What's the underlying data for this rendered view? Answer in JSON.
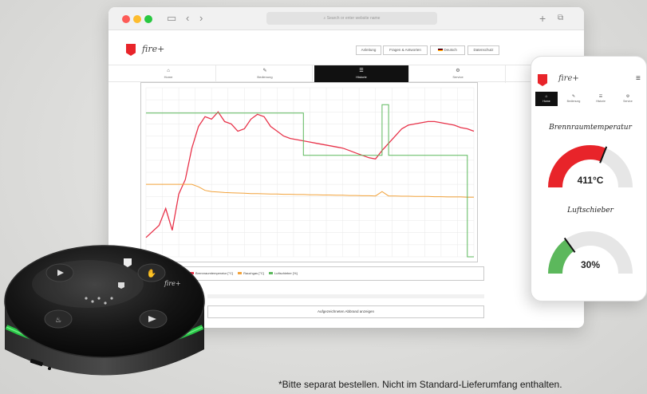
{
  "browser": {
    "url_placeholder": "Search or enter website name",
    "nav_icons": {
      "sidebar": "sidebar-icon",
      "back": "chevron-left-icon",
      "forward": "chevron-right-icon",
      "new_tab": "plus-icon",
      "tabs": "tabs-icon"
    }
  },
  "site": {
    "brand": "fire+",
    "nav_buttons": [
      "Anleitung",
      "Fragen & Antworten",
      "Deutsch",
      "Datenschutz"
    ],
    "tabs": [
      {
        "label": "Home",
        "icon": "home-icon",
        "active": false
      },
      {
        "label": "Bedienung",
        "icon": "wrench-icon",
        "active": false
      },
      {
        "label": "Historie",
        "icon": "history-icon",
        "active": true
      },
      {
        "label": "Service",
        "icon": "gear-icon",
        "active": false
      }
    ],
    "legend": [
      {
        "label": "Brennraumtemperatur [°C]",
        "color": "#e8334a"
      },
      {
        "label": "Rauchgas [°C]",
        "color": "#f2a23a"
      },
      {
        "label": "Luftschieber [%]",
        "color": "#5cb85c"
      }
    ],
    "archive_button": "Aufgezeichneten Abbrand anzeigen"
  },
  "chart_data": {
    "type": "line",
    "grid": true,
    "x": [
      0,
      4,
      6,
      8,
      10,
      12,
      14,
      16,
      18,
      20,
      22,
      24,
      26,
      28,
      30,
      32,
      34,
      36,
      38,
      40,
      42,
      44,
      46,
      48,
      50,
      52,
      54,
      56,
      58,
      60,
      62,
      64,
      66,
      68,
      70,
      72,
      74,
      76,
      78,
      80,
      82,
      84,
      86,
      88,
      90,
      92,
      94,
      96,
      98,
      100
    ],
    "series": [
      {
        "name": "Brennraumtemperatur [°C]",
        "color": "#e8334a",
        "values": [
          80,
          130,
          200,
          110,
          260,
          320,
          450,
          540,
          580,
          570,
          600,
          560,
          550,
          520,
          530,
          570,
          590,
          580,
          540,
          520,
          500,
          490,
          485,
          480,
          475,
          470,
          465,
          460,
          455,
          450,
          440,
          430,
          420,
          410,
          405,
          440,
          470,
          500,
          530,
          545,
          550,
          555,
          560,
          560,
          555,
          550,
          545,
          535,
          530,
          520
        ]
      },
      {
        "name": "Rauchgas [°C]",
        "color": "#f2a23a",
        "values": [
          300,
          300,
          300,
          300,
          300,
          300,
          300,
          290,
          275,
          270,
          268,
          266,
          265,
          264,
          263,
          262,
          262,
          261,
          260,
          260,
          259,
          259,
          258,
          258,
          257,
          257,
          256,
          256,
          255,
          255,
          254,
          254,
          253,
          253,
          252,
          270,
          252,
          252,
          251,
          251,
          250,
          250,
          250,
          249,
          249,
          248,
          248,
          248,
          247,
          247
        ]
      },
      {
        "name": "Luftschieber [%]",
        "color": "#5cb85c",
        "values": [
          85,
          85,
          85,
          85,
          85,
          85,
          85,
          85,
          85,
          85,
          85,
          85,
          85,
          85,
          85,
          85,
          85,
          85,
          85,
          85,
          85,
          85,
          85,
          60,
          60,
          60,
          60,
          60,
          60,
          60,
          60,
          60,
          60,
          60,
          60,
          90,
          60,
          60,
          60,
          60,
          60,
          60,
          60,
          60,
          60,
          60,
          60,
          60,
          0,
          0
        ]
      }
    ],
    "ylim": [
      0,
      700
    ],
    "ylim_right": [
      0,
      100
    ]
  },
  "phone": {
    "brand": "fire+",
    "tabs": [
      {
        "label": "Home",
        "icon": "home-icon",
        "active": true
      },
      {
        "label": "Bedienung",
        "icon": "wrench-icon",
        "active": false
      },
      {
        "label": "Historie",
        "icon": "history-icon",
        "active": false
      },
      {
        "label": "Service",
        "icon": "gear-icon",
        "active": false
      }
    ],
    "gauge1": {
      "title": "Brennraumtemperatur",
      "value": "411°C",
      "fraction": 0.62,
      "color": "#e8242a"
    },
    "gauge2": {
      "title": "Luftschieber",
      "value": "30%",
      "fraction": 0.3,
      "color": "#5cb85c"
    }
  },
  "device": {
    "glow_color": "#2ad14a",
    "buttons": [
      "play-icon",
      "hand-icon",
      "flame-icon",
      "arrow-left-icon",
      "arrow-right-icon"
    ]
  },
  "footnote": "*Bitte separat bestellen. Nicht im Standard-Lieferumfang enthalten."
}
